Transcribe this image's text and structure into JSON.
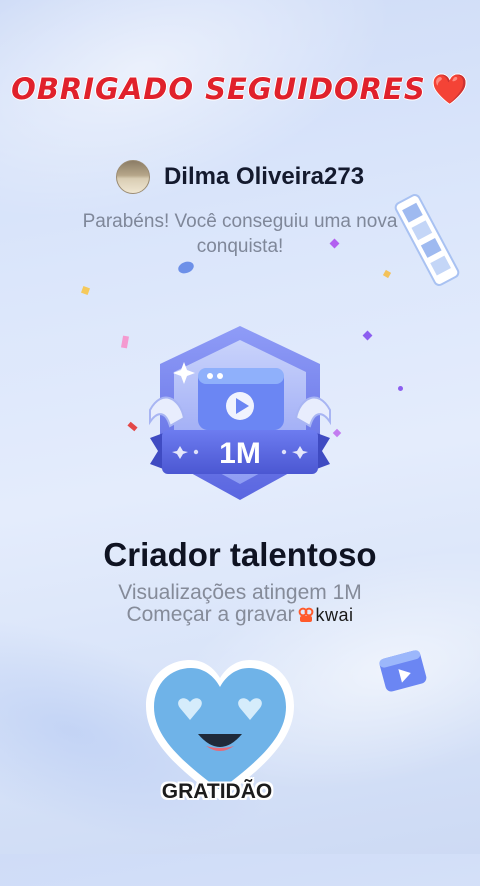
{
  "banner": {
    "text": "OBRIGADO SEGUIDORES",
    "heart_icon": "❤️"
  },
  "user": {
    "name": "Dilma Oliveira273"
  },
  "congrats": {
    "text": "Parabéns! Você conseguiu uma nova conquista!"
  },
  "badge": {
    "label": "1M"
  },
  "achievement": {
    "title": "Criador talentoso",
    "line1": "Visualizações atingem 1M",
    "line2": "Começar a gravar",
    "brand": "kwai"
  },
  "sticker": {
    "label": "GRATIDÃO"
  },
  "colors": {
    "banner_red": "#e0212b",
    "badge_purple": "#6f7ef0",
    "badge_dark": "#4d5bd6",
    "heart_blue": "#6fb3e8",
    "kwai_orange": "#ff5a2b"
  },
  "icons": [
    "heart-icon",
    "avatar",
    "achievement-badge",
    "play-icon",
    "film-strip-icon",
    "kwai-logo-icon",
    "heart-face-sticker"
  ]
}
